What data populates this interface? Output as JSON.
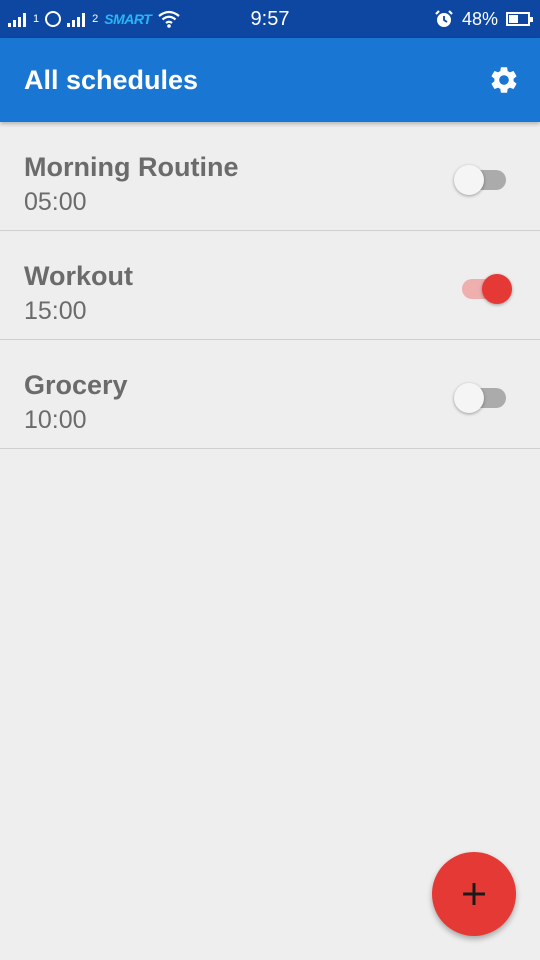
{
  "status_bar": {
    "time": "9:57",
    "battery_percent": "48%",
    "battery_level": 0.48,
    "sim1_number": "1",
    "sim2_number": "2",
    "carrier": "SMART",
    "icons": [
      "signal-icon",
      "globe-icon",
      "signal-icon",
      "wifi-icon",
      "alarm-icon",
      "battery-icon"
    ]
  },
  "app_bar": {
    "title": "All schedules",
    "settings_icon": "gear-icon",
    "color": "#1976d2"
  },
  "schedules": [
    {
      "name": "Morning Routine",
      "time": "05:00",
      "enabled": false
    },
    {
      "name": "Workout",
      "time": "15:00",
      "enabled": true
    },
    {
      "name": "Grocery",
      "time": "10:00",
      "enabled": false
    }
  ],
  "fab": {
    "icon": "plus-icon",
    "color": "#e53935"
  },
  "colors": {
    "status_bar": "#0d47a1",
    "background": "#eeeeee",
    "accent": "#e53935"
  }
}
